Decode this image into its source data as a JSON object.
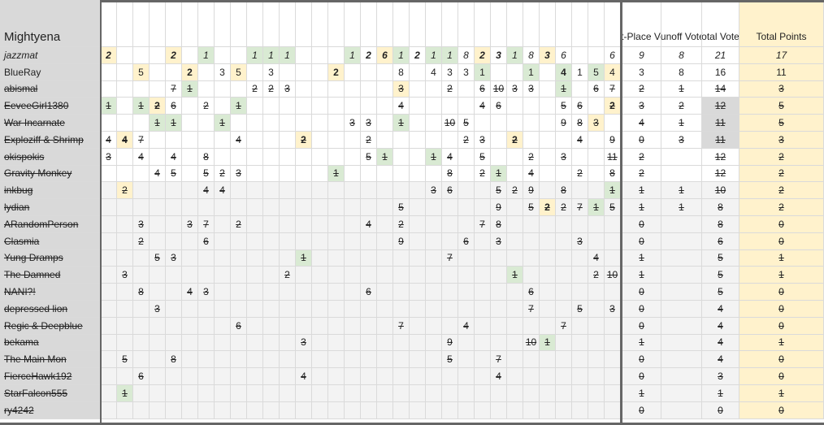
{
  "sheet_title": "Mightyena",
  "headers": {
    "first_place": "First-Place Votes",
    "runoff": "Runoff Votes",
    "total": "Total Votes",
    "points": "Total Points"
  },
  "colors": {
    "green": "#d9ead3",
    "yellow": "#fff2cc",
    "name_gray": "#d9d9d9",
    "row_gray": "#f3f3f3",
    "grid": "#dadada",
    "border": "#666666"
  },
  "rows": [
    {
      "name": "jazzmat",
      "style": "italic",
      "cells": [
        [
          0,
          "2",
          "Y",
          1
        ],
        [
          4,
          "2",
          "Y",
          1
        ],
        [
          6,
          "1",
          "G",
          0
        ],
        [
          9,
          "1",
          "G",
          0
        ],
        [
          10,
          "1",
          "G",
          0
        ],
        [
          11,
          "1",
          "G",
          0
        ],
        [
          15,
          "1",
          "G",
          0
        ],
        [
          16,
          "2",
          "",
          1
        ],
        [
          17,
          "6",
          "Y",
          1
        ],
        [
          18,
          "1",
          "G",
          0
        ],
        [
          19,
          "2",
          "",
          1
        ],
        [
          20,
          "1",
          "G",
          0
        ],
        [
          21,
          "1",
          "G",
          0
        ],
        [
          22,
          "8",
          "",
          0
        ],
        [
          23,
          "2",
          "Y",
          1
        ],
        [
          24,
          "3",
          "",
          1
        ],
        [
          25,
          "1",
          "G",
          0
        ],
        [
          26,
          "8",
          "",
          0
        ],
        [
          27,
          "3",
          "Y",
          1
        ],
        [
          28,
          "6",
          "",
          0
        ],
        [
          31,
          "6",
          "",
          0
        ]
      ],
      "first": "9",
      "runoff": "8",
      "total": "21",
      "points": "17",
      "shade": ""
    },
    {
      "name": "BlueRay",
      "style": "",
      "cells": [
        [
          2,
          "5",
          "Y",
          0
        ],
        [
          5,
          "2",
          "Y",
          1
        ],
        [
          7,
          "3",
          "",
          0
        ],
        [
          8,
          "5",
          "Y",
          0
        ],
        [
          10,
          "3",
          "",
          0
        ],
        [
          14,
          "2",
          "Y",
          1
        ],
        [
          18,
          "8",
          "",
          0
        ],
        [
          20,
          "4",
          "",
          0
        ],
        [
          21,
          "3",
          "",
          0
        ],
        [
          22,
          "3",
          "",
          0
        ],
        [
          23,
          "1",
          "G",
          0
        ],
        [
          26,
          "1",
          "G",
          0
        ],
        [
          28,
          "4",
          "G",
          1
        ],
        [
          29,
          "1",
          "",
          0
        ],
        [
          30,
          "5",
          "G",
          0
        ],
        [
          31,
          "4",
          "Y",
          0
        ]
      ],
      "first": "3",
      "runoff": "8",
      "total": "16",
      "points": "11",
      "shade": ""
    },
    {
      "name": "abismal",
      "style": "strike",
      "cells": [
        [
          4,
          "7",
          "",
          0
        ],
        [
          5,
          "1",
          "G",
          0
        ],
        [
          9,
          "2",
          "",
          0
        ],
        [
          10,
          "2",
          "",
          0
        ],
        [
          11,
          "3",
          "",
          0
        ],
        [
          18,
          "3",
          "Y",
          0
        ],
        [
          21,
          "2",
          "",
          0
        ],
        [
          23,
          "6",
          "",
          0
        ],
        [
          24,
          "10",
          "",
          0
        ],
        [
          25,
          "3",
          "",
          0
        ],
        [
          26,
          "3",
          "",
          0
        ],
        [
          28,
          "1",
          "G",
          0
        ],
        [
          30,
          "6",
          "",
          0
        ],
        [
          31,
          "7",
          "",
          0
        ]
      ],
      "first": "2",
      "runoff": "1",
      "total": "14",
      "points": "3",
      "shade": ""
    },
    {
      "name": "EeveeGirl1380",
      "style": "strike",
      "cells": [
        [
          0,
          "1",
          "G",
          0
        ],
        [
          2,
          "1",
          "G",
          0
        ],
        [
          3,
          "2",
          "Y",
          1
        ],
        [
          4,
          "6",
          "",
          0
        ],
        [
          6,
          "2",
          "",
          0
        ],
        [
          8,
          "1",
          "G",
          0
        ],
        [
          18,
          "4",
          "",
          0
        ],
        [
          23,
          "4",
          "",
          0
        ],
        [
          24,
          "6",
          "",
          0
        ],
        [
          28,
          "5",
          "",
          0
        ],
        [
          29,
          "6",
          "",
          0
        ],
        [
          31,
          "2",
          "Y",
          1
        ]
      ],
      "first": "3",
      "runoff": "2",
      "total": "12",
      "points": "5",
      "shade": "total"
    },
    {
      "name": "War Incarnate",
      "style": "strike",
      "cells": [
        [
          3,
          "1",
          "G",
          0
        ],
        [
          4,
          "1",
          "G",
          0
        ],
        [
          7,
          "1",
          "G",
          0
        ],
        [
          15,
          "3",
          "",
          0
        ],
        [
          16,
          "3",
          "",
          0
        ],
        [
          18,
          "1",
          "G",
          0
        ],
        [
          21,
          "10",
          "",
          0
        ],
        [
          22,
          "5",
          "",
          0
        ],
        [
          28,
          "9",
          "",
          0
        ],
        [
          29,
          "8",
          "",
          0
        ],
        [
          30,
          "3",
          "Y",
          0
        ]
      ],
      "first": "4",
      "runoff": "1",
      "total": "11",
      "points": "5",
      "shade": "total"
    },
    {
      "name": "Exploziff & Shrimp",
      "style": "strike",
      "cells": [
        [
          0,
          "4",
          "",
          0
        ],
        [
          1,
          "4",
          "Y",
          1
        ],
        [
          2,
          "7",
          "",
          0
        ],
        [
          8,
          "4",
          "",
          0
        ],
        [
          12,
          "2",
          "Y",
          1
        ],
        [
          16,
          "2",
          "",
          0
        ],
        [
          22,
          "2",
          "",
          0
        ],
        [
          23,
          "3",
          "",
          0
        ],
        [
          25,
          "2",
          "Y",
          1
        ],
        [
          29,
          "4",
          "",
          0
        ],
        [
          31,
          "9",
          "",
          0
        ]
      ],
      "first": "0",
      "runoff": "3",
      "total": "11",
      "points": "3",
      "shade": "total"
    },
    {
      "name": "okispokis",
      "style": "strike",
      "cells": [
        [
          0,
          "3",
          "",
          0
        ],
        [
          2,
          "4",
          "",
          0
        ],
        [
          4,
          "4",
          "",
          0
        ],
        [
          6,
          "8",
          "",
          0
        ],
        [
          16,
          "5",
          "",
          0
        ],
        [
          17,
          "1",
          "G",
          0
        ],
        [
          20,
          "1",
          "G",
          0
        ],
        [
          21,
          "4",
          "",
          0
        ],
        [
          23,
          "5",
          "",
          0
        ],
        [
          26,
          "2",
          "",
          0
        ],
        [
          28,
          "3",
          "",
          0
        ],
        [
          31,
          "11",
          "",
          0
        ]
      ],
      "first": "2",
      "runoff": "",
      "total": "12",
      "points": "2",
      "shade": ""
    },
    {
      "name": "Gravity Monkey",
      "style": "strike",
      "cells": [
        [
          3,
          "4",
          "",
          0
        ],
        [
          4,
          "5",
          "",
          0
        ],
        [
          6,
          "5",
          "",
          0
        ],
        [
          7,
          "2",
          "",
          0
        ],
        [
          8,
          "3",
          "",
          0
        ],
        [
          14,
          "1",
          "G",
          0
        ],
        [
          21,
          "8",
          "",
          0
        ],
        [
          23,
          "2",
          "",
          0
        ],
        [
          24,
          "1",
          "G",
          0
        ],
        [
          26,
          "4",
          "",
          0
        ],
        [
          29,
          "2",
          "",
          0
        ],
        [
          31,
          "8",
          "",
          0
        ]
      ],
      "first": "2",
      "runoff": "",
      "total": "12",
      "points": "2",
      "shade": ""
    },
    {
      "name": "inkbug",
      "style": "strike",
      "cells": [
        [
          1,
          "2",
          "Y",
          0
        ],
        [
          6,
          "4",
          "",
          0
        ],
        [
          7,
          "4",
          "",
          0
        ],
        [
          20,
          "3",
          "",
          0
        ],
        [
          21,
          "6",
          "",
          0
        ],
        [
          24,
          "5",
          "",
          0
        ],
        [
          25,
          "2",
          "",
          0
        ],
        [
          26,
          "9",
          "",
          0
        ],
        [
          28,
          "8",
          "",
          0
        ],
        [
          31,
          "1",
          "G",
          0
        ]
      ],
      "first": "1",
      "runoff": "1",
      "total": "10",
      "points": "2",
      "shade": ""
    },
    {
      "name": "lydian",
      "style": "strike",
      "cells": [
        [
          18,
          "5",
          "",
          0
        ],
        [
          24,
          "9",
          "",
          0
        ],
        [
          26,
          "5",
          "",
          0
        ],
        [
          27,
          "2",
          "Y",
          1
        ],
        [
          28,
          "2",
          "",
          0
        ],
        [
          29,
          "7",
          "",
          0
        ],
        [
          30,
          "1",
          "G",
          0
        ],
        [
          31,
          "5",
          "",
          0
        ]
      ],
      "first": "1",
      "runoff": "1",
      "total": "8",
      "points": "2",
      "shade": ""
    },
    {
      "name": "ARandomPerson",
      "style": "strike",
      "cells": [
        [
          2,
          "3",
          "",
          0
        ],
        [
          5,
          "3",
          "",
          0
        ],
        [
          6,
          "7",
          "",
          0
        ],
        [
          8,
          "2",
          "",
          0
        ],
        [
          16,
          "4",
          "",
          0
        ],
        [
          18,
          "2",
          "",
          0
        ],
        [
          23,
          "7",
          "",
          0
        ],
        [
          24,
          "8",
          "",
          0
        ]
      ],
      "first": "0",
      "runoff": "",
      "total": "8",
      "points": "0",
      "shade": ""
    },
    {
      "name": "Clasmia",
      "style": "strike",
      "cells": [
        [
          2,
          "2",
          "",
          0
        ],
        [
          6,
          "6",
          "",
          0
        ],
        [
          18,
          "9",
          "",
          0
        ],
        [
          22,
          "6",
          "",
          0
        ],
        [
          24,
          "3",
          "",
          0
        ],
        [
          29,
          "3",
          "",
          0
        ]
      ],
      "first": "0",
      "runoff": "",
      "total": "6",
      "points": "0",
      "shade": ""
    },
    {
      "name": "Yung Dramps",
      "style": "strike",
      "cells": [
        [
          3,
          "5",
          "",
          0
        ],
        [
          4,
          "3",
          "",
          0
        ],
        [
          12,
          "1",
          "G",
          0
        ],
        [
          21,
          "7",
          "",
          0
        ],
        [
          30,
          "4",
          "",
          0
        ]
      ],
      "first": "1",
      "runoff": "",
      "total": "5",
      "points": "1",
      "shade": ""
    },
    {
      "name": "The Damned",
      "style": "strike",
      "cells": [
        [
          1,
          "3",
          "",
          0
        ],
        [
          11,
          "2",
          "",
          0
        ],
        [
          25,
          "1",
          "G",
          0
        ],
        [
          30,
          "2",
          "",
          0
        ],
        [
          31,
          "10",
          "",
          0
        ]
      ],
      "first": "1",
      "runoff": "",
      "total": "5",
      "points": "1",
      "shade": ""
    },
    {
      "name": "NANI?!",
      "style": "strike",
      "cells": [
        [
          2,
          "8",
          "",
          0
        ],
        [
          5,
          "4",
          "",
          0
        ],
        [
          6,
          "3",
          "",
          0
        ],
        [
          16,
          "6",
          "",
          0
        ],
        [
          26,
          "6",
          "",
          0
        ]
      ],
      "first": "0",
      "runoff": "",
      "total": "5",
      "points": "0",
      "shade": ""
    },
    {
      "name": "depressed lion",
      "style": "strike",
      "cells": [
        [
          3,
          "3",
          "",
          0
        ],
        [
          26,
          "7",
          "",
          0
        ],
        [
          29,
          "5",
          "",
          0
        ],
        [
          31,
          "3",
          "",
          0
        ]
      ],
      "first": "0",
      "runoff": "",
      "total": "4",
      "points": "0",
      "shade": ""
    },
    {
      "name": "Regic & Deepblue",
      "style": "strike",
      "cells": [
        [
          8,
          "6",
          "",
          0
        ],
        [
          18,
          "7",
          "",
          0
        ],
        [
          22,
          "4",
          "",
          0
        ],
        [
          28,
          "7",
          "",
          0
        ]
      ],
      "first": "0",
      "runoff": "",
      "total": "4",
      "points": "0",
      "shade": ""
    },
    {
      "name": "bekama",
      "style": "strike",
      "cells": [
        [
          12,
          "3",
          "",
          0
        ],
        [
          21,
          "9",
          "",
          0
        ],
        [
          26,
          "10",
          "",
          0
        ],
        [
          27,
          "1",
          "G",
          0
        ]
      ],
      "first": "1",
      "runoff": "",
      "total": "4",
      "points": "1",
      "shade": ""
    },
    {
      "name": "The Main Mon",
      "style": "strike",
      "cells": [
        [
          1,
          "5",
          "",
          0
        ],
        [
          4,
          "8",
          "",
          0
        ],
        [
          21,
          "5",
          "",
          0
        ],
        [
          24,
          "7",
          "",
          0
        ]
      ],
      "first": "0",
      "runoff": "",
      "total": "4",
      "points": "0",
      "shade": ""
    },
    {
      "name": "FierceHawk192",
      "style": "strike",
      "cells": [
        [
          2,
          "6",
          "",
          0
        ],
        [
          12,
          "4",
          "",
          0
        ],
        [
          24,
          "4",
          "",
          0
        ]
      ],
      "first": "0",
      "runoff": "",
      "total": "3",
      "points": "0",
      "shade": ""
    },
    {
      "name": "StarFalcon555",
      "style": "strike",
      "cells": [
        [
          1,
          "1",
          "G",
          0
        ]
      ],
      "first": "1",
      "runoff": "",
      "total": "1",
      "points": "1",
      "shade": ""
    },
    {
      "name": "ry4242",
      "style": "strike",
      "cells": [],
      "first": "0",
      "runoff": "",
      "total": "0",
      "points": "0",
      "shade": ""
    }
  ]
}
